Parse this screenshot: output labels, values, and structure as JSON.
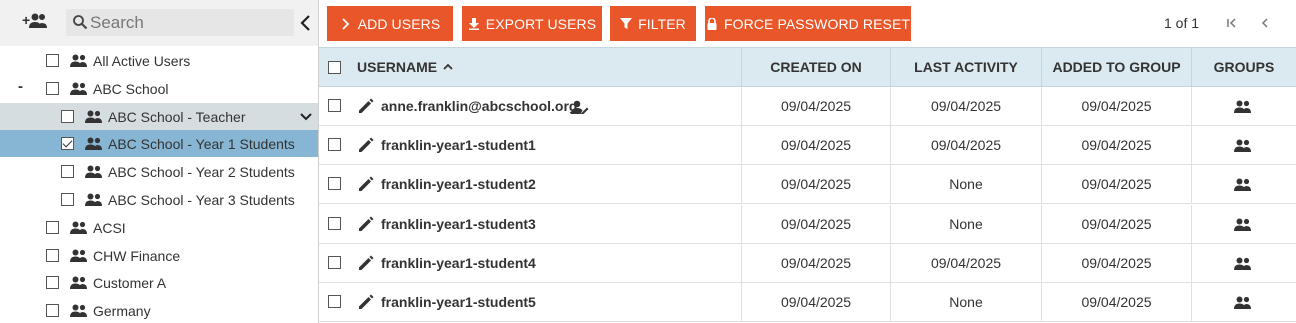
{
  "sidebar": {
    "search_placeholder": "Search",
    "tree": [
      {
        "label": "All Active Users",
        "checked": false
      },
      {
        "label": "ABC School",
        "checked": false,
        "expanded": true
      },
      {
        "label": "ABC School - Teacher",
        "checked": false
      },
      {
        "label": "ABC School - Year 1 Students",
        "checked": true
      },
      {
        "label": "ABC School - Year 2 Students",
        "checked": false
      },
      {
        "label": "ABC School - Year 3 Students",
        "checked": false
      },
      {
        "label": "ACSI",
        "checked": false
      },
      {
        "label": "CHW Finance",
        "checked": false
      },
      {
        "label": "Customer A",
        "checked": false
      },
      {
        "label": "Germany",
        "checked": false
      }
    ],
    "expand_marker": "-"
  },
  "toolbar": {
    "add_users": "ADD USERS",
    "export_users": "EXPORT USERS",
    "filter": "FILTER",
    "force_reset": "FORCE PASSWORD RESET"
  },
  "pager": {
    "text": "1 of 1"
  },
  "table": {
    "columns": [
      "USERNAME",
      "CREATED ON",
      "LAST ACTIVITY",
      "ADDED TO GROUP",
      "GROUPS"
    ],
    "sort_indicator": "^",
    "rows": [
      {
        "username": "anne.franklin@abcschool.org",
        "created": "09/04/2025",
        "last": "09/04/2025",
        "added": "09/04/2025",
        "admin": true
      },
      {
        "username": "franklin-year1-student1",
        "created": "09/04/2025",
        "last": "09/04/2025",
        "added": "09/04/2025",
        "admin": false
      },
      {
        "username": "franklin-year1-student2",
        "created": "09/04/2025",
        "last": "None",
        "added": "09/04/2025",
        "admin": false
      },
      {
        "username": "franklin-year1-student3",
        "created": "09/04/2025",
        "last": "None",
        "added": "09/04/2025",
        "admin": false
      },
      {
        "username": "franklin-year1-student4",
        "created": "09/04/2025",
        "last": "09/04/2025",
        "added": "09/04/2025",
        "admin": false
      },
      {
        "username": "franklin-year1-student5",
        "created": "09/04/2025",
        "last": "None",
        "added": "09/04/2025",
        "admin": false
      }
    ]
  },
  "colors": {
    "accent": "#e8562a",
    "header_bg": "#dbe9f1",
    "selected": "#87b6d4",
    "highlight": "#d6dde0"
  }
}
